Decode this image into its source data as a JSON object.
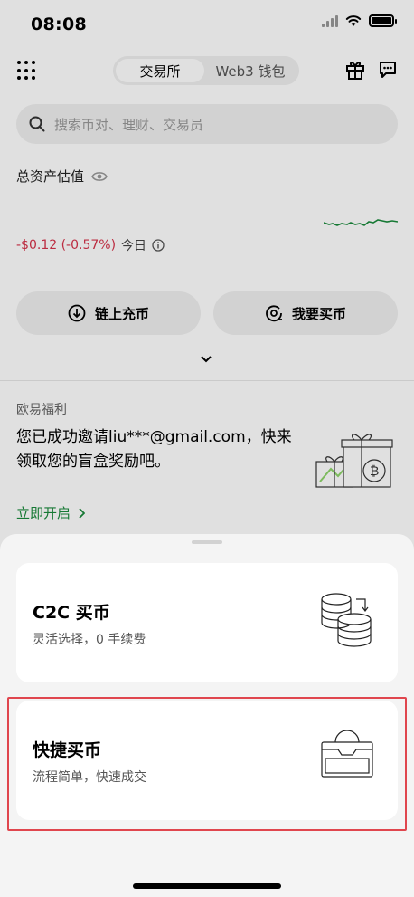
{
  "status_bar": {
    "time": "08:08"
  },
  "header": {
    "tabs": [
      {
        "label": "交易所",
        "active": true
      },
      {
        "label": "Web3 钱包",
        "active": false
      }
    ]
  },
  "search": {
    "placeholder": "搜索币对、理财、交易员"
  },
  "assets": {
    "label": "总资产估值",
    "pnl_value": "-$0.12 (-0.57%)",
    "pnl_period": "今日"
  },
  "actions": [
    {
      "label": "链上充币",
      "icon": "download-icon"
    },
    {
      "label": "我要买币",
      "icon": "buy-coin-icon"
    }
  ],
  "welfare": {
    "title": "欧易福利",
    "text": "您已成功邀请liu***@gmail.com，快来领取您的盲盒奖励吧。",
    "link": "立即开启"
  },
  "sheet": {
    "options": [
      {
        "title": "C2C 买币",
        "subtitle": "灵活选择，0 手续费",
        "icon": "coins-exchange-icon"
      },
      {
        "title": "快捷买币",
        "subtitle": "流程简单，快速成交",
        "icon": "wallet-coin-icon"
      }
    ]
  },
  "colors": {
    "negative": "#d6334a",
    "positive": "#1a8a3c",
    "highlight": "#e0464e"
  }
}
